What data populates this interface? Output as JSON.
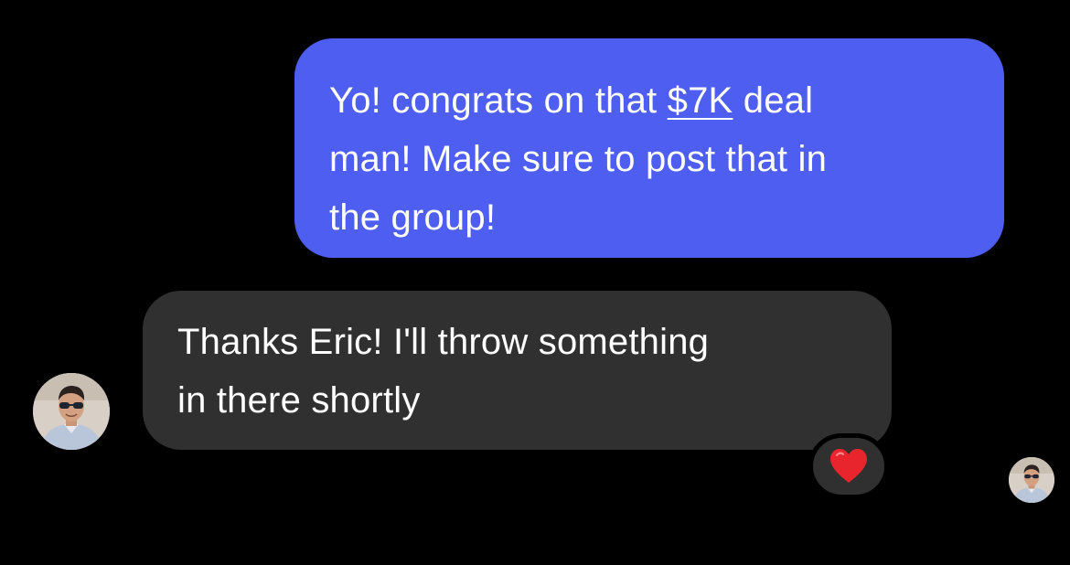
{
  "conversation": {
    "sent_message": {
      "line1_before": "Yo! congrats on that ",
      "line1_link": "$7K",
      "line1_after": " deal",
      "line2": "man! Make sure to post that in",
      "line3": "the group!"
    },
    "received_message": {
      "line1": "Thanks Eric! I'll throw something",
      "line2": "in there shortly"
    },
    "reaction": {
      "icon": "red-heart-icon",
      "color": "#e8242c"
    }
  },
  "colors": {
    "background": "#000000",
    "sent_bubble": "#4d5ef1",
    "received_bubble": "#303030",
    "text": "#ffffff"
  }
}
